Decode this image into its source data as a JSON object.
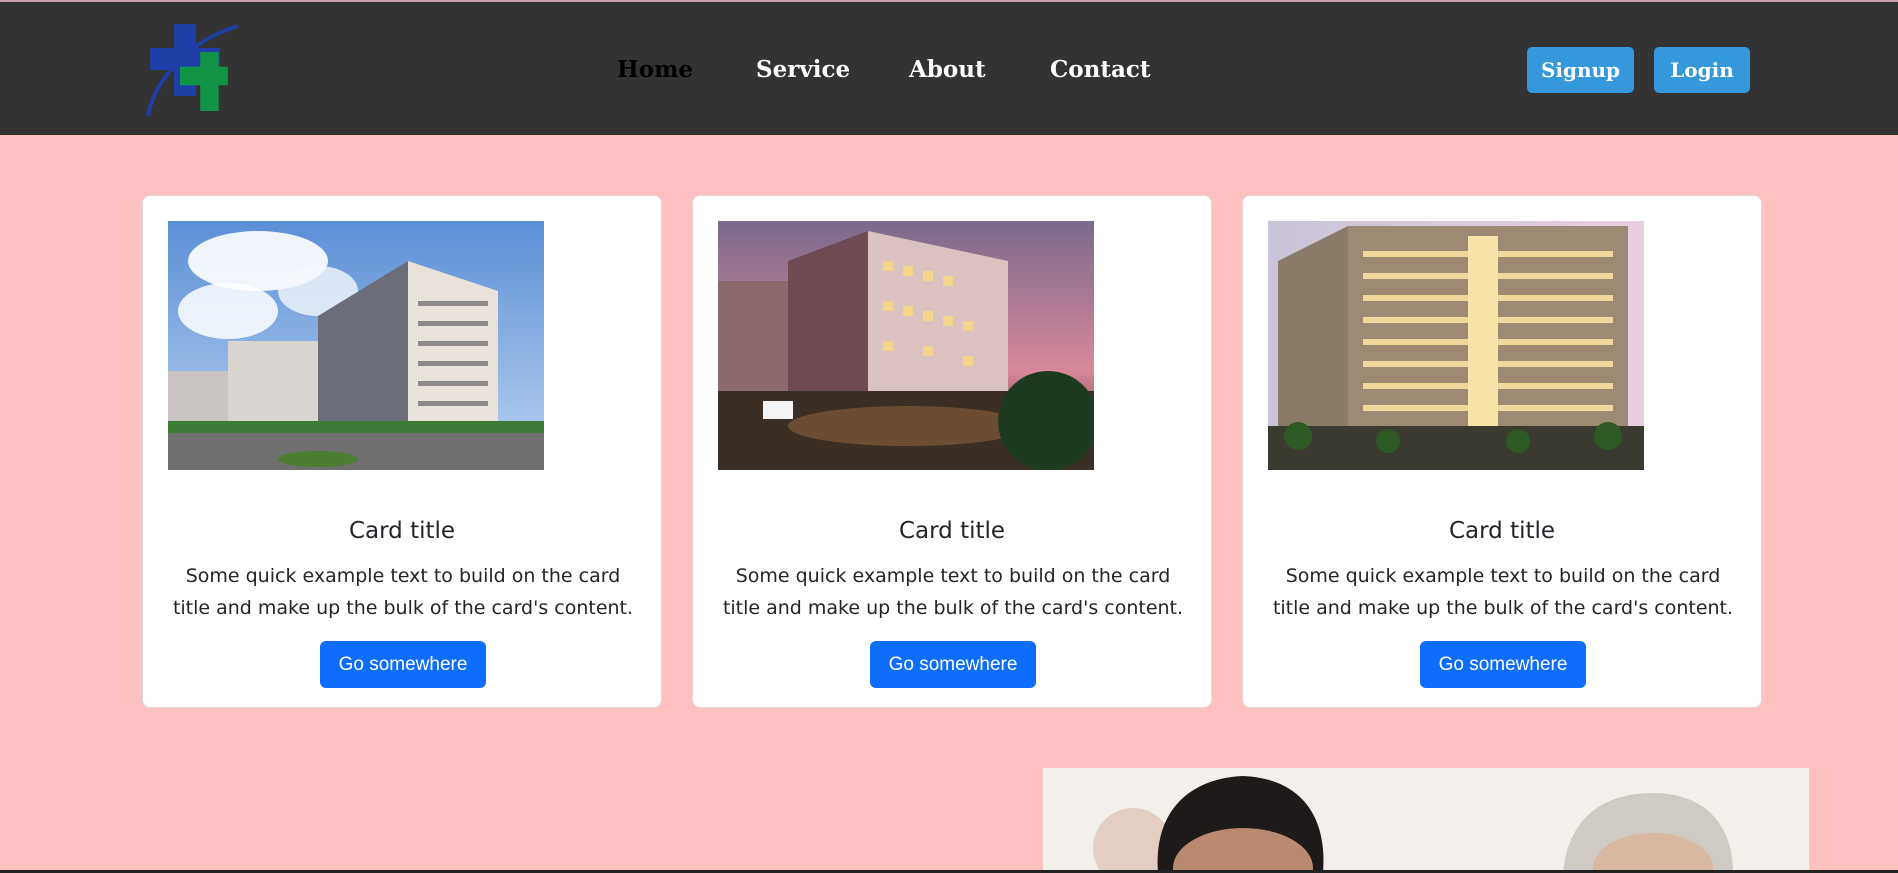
{
  "navbar": {
    "links": [
      {
        "label": "Home",
        "active": true
      },
      {
        "label": "Service",
        "active": false
      },
      {
        "label": "About",
        "active": false
      },
      {
        "label": "Contact",
        "active": false
      }
    ],
    "signup_label": "Signup",
    "login_label": "Login",
    "logo_icon": "medical-cross-logo"
  },
  "cards": [
    {
      "image_icon": "hospital-building-daytime",
      "title": "Card title",
      "text": "Some quick example text to build on the card title and make up the bulk of the card's content.",
      "button_label": "Go somewhere"
    },
    {
      "image_icon": "hospital-building-dusk",
      "title": "Card title",
      "text": "Some quick example text to build on the card title and make up the bulk of the card's content.",
      "button_label": "Go somewhere"
    },
    {
      "image_icon": "hospital-building-night",
      "title": "Card title",
      "text": "Some quick example text to build on the card title and make up the bulk of the card's content.",
      "button_label": "Go somewhere"
    }
  ],
  "colors": {
    "page_background": "#ffc0c0",
    "navbar_background": "#333333",
    "auth_button": "#3498db",
    "card_button": "#0d6efd"
  }
}
